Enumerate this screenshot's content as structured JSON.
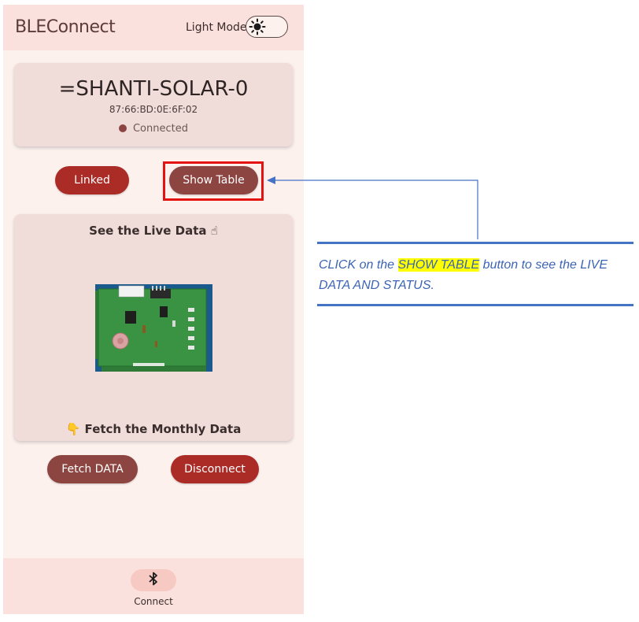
{
  "appbar": {
    "title": "BLEConnect",
    "light_mode_label": "Light Mode",
    "toggle_icon": "sun-icon"
  },
  "device": {
    "name": "=SHANTI-SOLAR-0",
    "mac": "87:66:BD:0E:6F:02",
    "status": "Connected",
    "status_color": "#8b4542"
  },
  "actions": {
    "linked_label": "Linked",
    "show_table_label": "Show Table",
    "fetch_label": "Fetch DATA",
    "disconnect_label": "Disconnect"
  },
  "live_card": {
    "title": "See the Live Data ☝",
    "fetch_title": "👇 Fetch the Monthly Data",
    "image": "pcb-board-image"
  },
  "bottom_nav": {
    "icon": "bluetooth-icon",
    "label": "Connect"
  },
  "annotation": {
    "text_before": "CLICK on the ",
    "highlight": "SHOW TABLE",
    "text_after": " button to see the LIVE DATA AND STATUS.",
    "color": "#3c64b4",
    "highlight_color": "#ffff00",
    "box_color": "#e4130f"
  },
  "colors": {
    "primary_red": "#ab2b27",
    "secondary_brown": "#8c4541",
    "background": "#fdf1ee",
    "card": "#f0dcd8"
  }
}
